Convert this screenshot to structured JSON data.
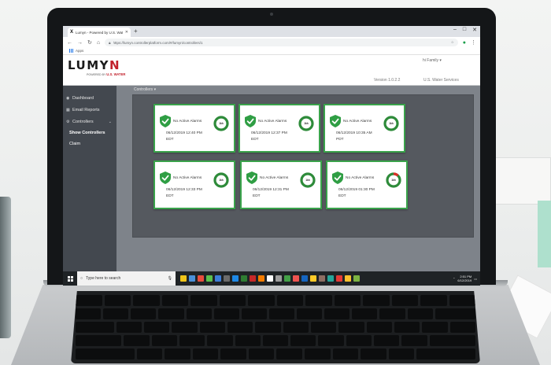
{
  "browser": {
    "tab_title": "Lumyn - Powered by U.S. Water",
    "tab_logo": "X",
    "url": "https://lumyn.controllerplatform.com/#/lumyn/controllers/1",
    "bookmarks_label": "Apps"
  },
  "app": {
    "logo_text": "LUMY",
    "logo_accent": "N",
    "logo_powered": "POWERED BY",
    "logo_brand": "U.S. WATER",
    "user_menu": "hi Family ▾",
    "version": "Version 1.0.2.2",
    "company": "U.S. Water Services"
  },
  "sidebar": {
    "items": [
      {
        "icon": "dashboard-icon",
        "glyph": "◉",
        "label": "Dashboard"
      },
      {
        "icon": "email-icon",
        "glyph": "▦",
        "label": "Email Reports"
      },
      {
        "icon": "controllers-icon",
        "glyph": "⚙",
        "label": "Controllers"
      }
    ],
    "sub_items": [
      {
        "label": "Show Controllers",
        "active": true
      },
      {
        "label": "Claim",
        "active": false
      }
    ]
  },
  "main": {
    "breadcrumb": "Controllers ▾",
    "cards": [
      {
        "status": "No Active Alarms",
        "date": "06/12/2019 12:40 PM",
        "tz": "EDT",
        "gauge": "1kh",
        "gauge_fraction": 0.0
      },
      {
        "status": "No Active Alarms",
        "date": "06/12/2019 12:37 PM",
        "tz": "EDT",
        "gauge": "1kh",
        "gauge_fraction": 0.0
      },
      {
        "status": "No Active Alarms",
        "date": "06/12/2019 10:35 AM",
        "tz": "PDT",
        "gauge": "1kh",
        "gauge_fraction": 0.0
      },
      {
        "status": "No Active Alarms",
        "date": "06/12/2019 12:33 PM",
        "tz": "EDT",
        "gauge": "1kh",
        "gauge_fraction": 0.0
      },
      {
        "status": "No Active Alarms",
        "date": "06/12/2019 12:31 PM",
        "tz": "EDT",
        "gauge": "1kh",
        "gauge_fraction": 0.0
      },
      {
        "status": "No Active Alarms",
        "date": "06/12/2019 01:30 PM",
        "tz": "EDT",
        "gauge": "1kh",
        "gauge_fraction": 0.12
      }
    ]
  },
  "taskbar": {
    "search_placeholder": "Type here to search",
    "time": "2:51 PM",
    "date": "6/12/2019",
    "icon_colors": [
      "#f0c419",
      "#4a90d9",
      "#e84c3d",
      "#5bbf4c",
      "#3d7dd8",
      "#6b6b6b",
      "#1e88e5",
      "#2e7d32",
      "#c62828",
      "#f57c00",
      "#ffffff",
      "#9e9e9e",
      "#43a047",
      "#ef5350",
      "#1565c0",
      "#ffca28",
      "#8d6e63",
      "#26a69a",
      "#e53935",
      "#fbc02d",
      "#7cb342"
    ]
  },
  "colors": {
    "card_border": "#3aa34b",
    "shield": "#2f9e44",
    "gauge_ring": "#2e8b3a",
    "gauge_alert": "#d93025",
    "sidebar_bg": "#43484f",
    "main_bg": "#7e838a",
    "brand_red": "#c2202b"
  }
}
